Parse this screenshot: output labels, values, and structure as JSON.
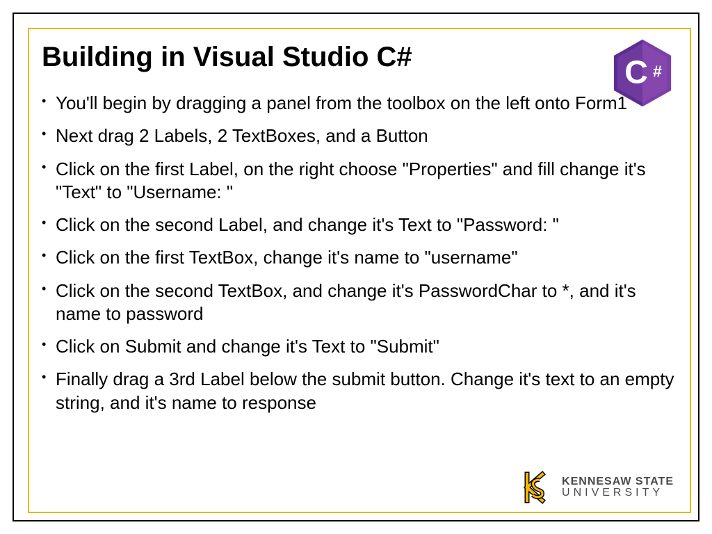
{
  "slide": {
    "title": "Building in Visual Studio C#",
    "bullets": [
      "You'll begin by dragging a panel from the toolbox on the left onto Form1",
      "Next drag 2 Labels, 2 TextBoxes, and a Button",
      "Click on the first Label, on the right choose \"Properties\" and fill change it's \"Text\" to \"Username: \"",
      "Click on the second Label, and change it's Text to \"Password: \"",
      "Click on the first TextBox, change it's name to \"username\"",
      "Click on the second TextBox, and change it's PasswordChar to *, and it's name to password",
      "Click on Submit and change it's Text to \"Submit\"",
      "Finally drag a 3rd Label below the submit button.  Change it's text to an empty string, and it's name to response"
    ]
  },
  "logos": {
    "csharp_letter": "C",
    "csharp_hash": "#",
    "ksu_line1": "KENNESAW STATE",
    "ksu_line2": "UNIVERSITY"
  }
}
